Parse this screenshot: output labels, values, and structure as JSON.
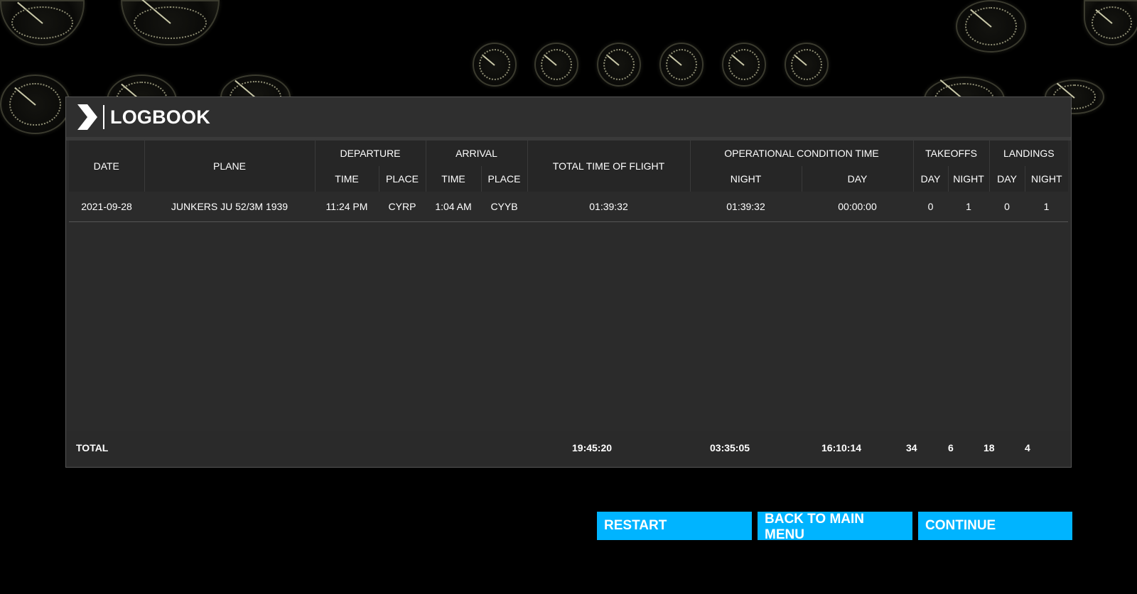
{
  "panel": {
    "title": "LOGBOOK"
  },
  "table": {
    "headers": {
      "date": "DATE",
      "plane": "PLANE",
      "departure": "DEPARTURE",
      "arrival": "ARRIVAL",
      "total_time": "TOTAL TIME OF FLIGHT",
      "operational": "OPERATIONAL CONDITION TIME",
      "takeoffs": "TAKEOFFS",
      "landings": "LANDINGS",
      "dep_time": "TIME",
      "dep_place": "PLACE",
      "arr_time": "TIME",
      "arr_place": "PLACE",
      "op_night": "NIGHT",
      "op_day": "DAY",
      "to_day": "DAY",
      "to_night": "NIGHT",
      "ld_day": "DAY",
      "ld_night": "NIGHT"
    },
    "rows": [
      {
        "date": "2021-09-28",
        "plane": "JUNKERS JU 52/3M 1939",
        "dep_time": "11:24 PM",
        "dep_place": "CYRP",
        "arr_time": "1:04 AM",
        "arr_place": "CYYB",
        "total_time": "01:39:32",
        "op_night": "01:39:32",
        "op_day": "00:00:00",
        "to_day": "0",
        "to_night": "1",
        "ld_day": "0",
        "ld_night": "1"
      }
    ],
    "totals": {
      "label": "TOTAL",
      "total_time": "19:45:20",
      "op_night": "03:35:05",
      "op_day": "16:10:14",
      "to_day": "34",
      "to_night": "6",
      "ld_day": "18",
      "ld_night": "4"
    }
  },
  "buttons": {
    "restart": "RESTART",
    "back": "BACK TO MAIN MENU",
    "continue": "CONTINUE"
  },
  "colors": {
    "accent": "#00b4ff",
    "panel": "#2c2c2c"
  }
}
